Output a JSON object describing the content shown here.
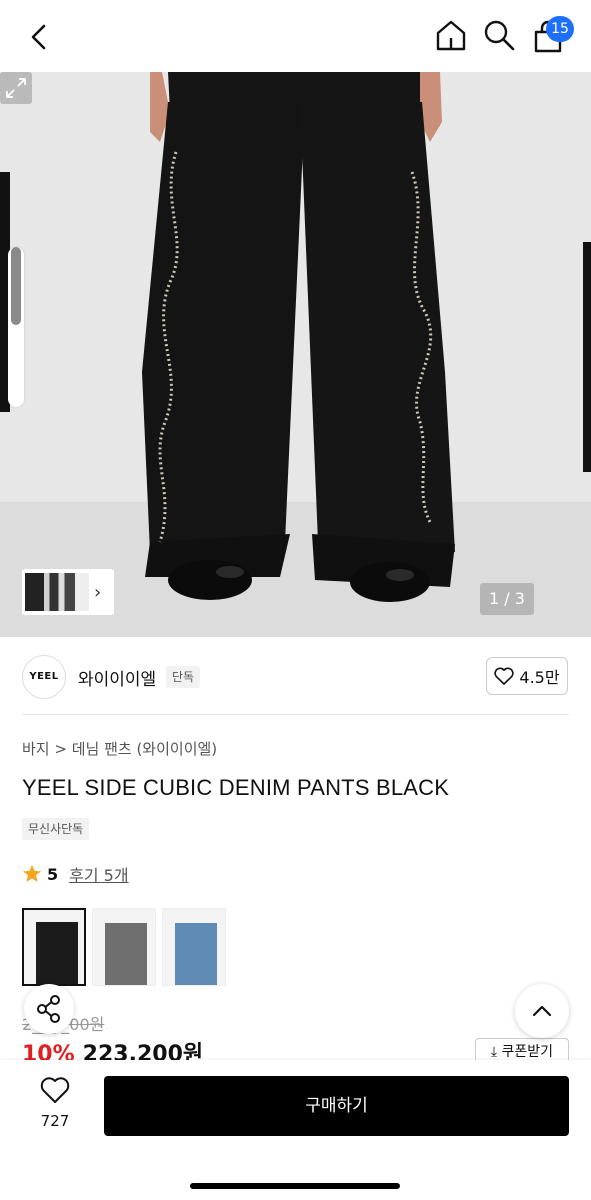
{
  "header": {
    "cart_count": "15",
    "icons": [
      "back-icon",
      "home-icon",
      "search-icon",
      "shopping-bag-icon"
    ]
  },
  "gallery": {
    "counter": "1 / 3",
    "icons": [
      "expand-icon",
      "chevron-right-icon"
    ]
  },
  "brand": {
    "logo_text": "YEEL",
    "name": "와이이이엘",
    "badge": "단독",
    "likes": "4.5만"
  },
  "product": {
    "breadcrumb": "바지 > 데님 팬츠 (와이이이엘)",
    "title": "YEEL SIDE CUBIC DENIM PANTS BLACK",
    "tag": "무신사단독",
    "rating": "5",
    "reviews": "후기 5개",
    "old_price": "2___,_00원",
    "discount": "10%",
    "price": "223,200원",
    "coupon": "쿠폰받기"
  },
  "variants": [
    {
      "name": "black",
      "color": "#1b1b1b"
    },
    {
      "name": "grey",
      "color": "#6e6e6e"
    },
    {
      "name": "blue",
      "color": "#5f8bb5"
    }
  ],
  "bottom": {
    "wish_count": "727",
    "buy_label": "구매하기"
  },
  "colors": {
    "accent": "#1f6fff",
    "discount": "#e02020",
    "star": "#f5a623"
  }
}
